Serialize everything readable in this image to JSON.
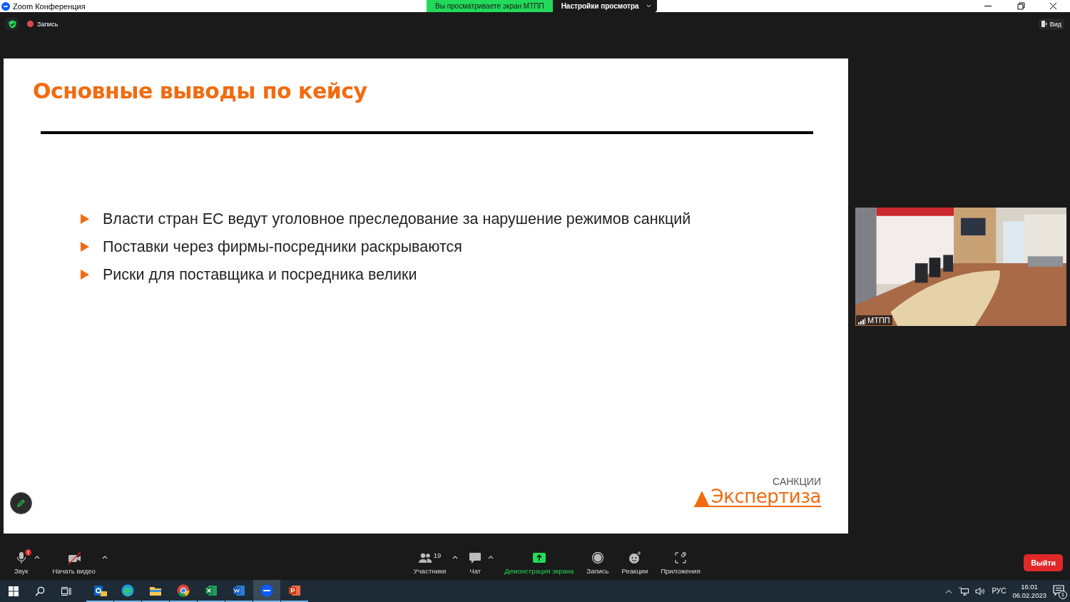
{
  "window": {
    "title": "Zoom Конференция"
  },
  "share_banner": {
    "status": "Вы просматриваете экран МТПП",
    "settings": "Настройки просмотра"
  },
  "top_bar": {
    "recording": "Запись",
    "view": "Вид"
  },
  "slide": {
    "title": "Основные выводы по кейсу",
    "bullets": [
      "Власти стран ЕС ведут уголовное преследование за нарушение режимов санкций",
      "Поставки через фирмы-посредники раскрываются",
      "Риски для поставщика и посредника велики"
    ],
    "logo": {
      "top": "САНКЦИИ",
      "main": "Экспертиза"
    }
  },
  "video_tile": {
    "kind": "picture",
    "name": "МТПП"
  },
  "toolbar": {
    "items": [
      {
        "kind": "mic",
        "label": "Звук",
        "caret": true,
        "active": false,
        "warning": true
      },
      {
        "kind": "video",
        "label": "Начать видео",
        "caret": true,
        "active": false,
        "warning": false
      },
      {
        "kind": "participants",
        "label": "Участники",
        "count": "19",
        "caret": true,
        "active": false,
        "warning": false
      },
      {
        "kind": "chat",
        "label": "Чат",
        "caret": true,
        "active": false,
        "warning": false
      },
      {
        "kind": "share",
        "label": "Демонстрация экрана",
        "caret": false,
        "active": true,
        "warning": false
      },
      {
        "kind": "record",
        "label": "Запись",
        "caret": false,
        "active": false,
        "warning": false
      },
      {
        "kind": "reactions",
        "label": "Реакции",
        "caret": false,
        "active": false,
        "warning": false
      },
      {
        "kind": "apps",
        "label": "Приложения",
        "caret": false,
        "active": false,
        "warning": false
      }
    ],
    "leave": "Выйти"
  },
  "taskbar": {
    "apps": [
      {
        "kind": "outlook",
        "selected": false
      },
      {
        "kind": "edge",
        "selected": false
      },
      {
        "kind": "explorer",
        "selected": false
      },
      {
        "kind": "chrome",
        "selected": false
      },
      {
        "kind": "excel",
        "selected": false
      },
      {
        "kind": "word",
        "selected": false
      },
      {
        "kind": "zoom",
        "selected": true
      },
      {
        "kind": "powerpoint",
        "selected": false
      }
    ],
    "language": "РУС",
    "time": "16:01",
    "date": "06.02.2023",
    "notifications": "1"
  }
}
